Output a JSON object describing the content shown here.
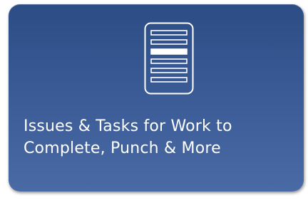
{
  "tile": {
    "icon": "task-list-icon",
    "label": "Issues & Tasks for Work to Complete, Punch & More",
    "background": "#3a5a95",
    "text_color": "#ffffff",
    "highlight_row_color": "#ffffff"
  }
}
